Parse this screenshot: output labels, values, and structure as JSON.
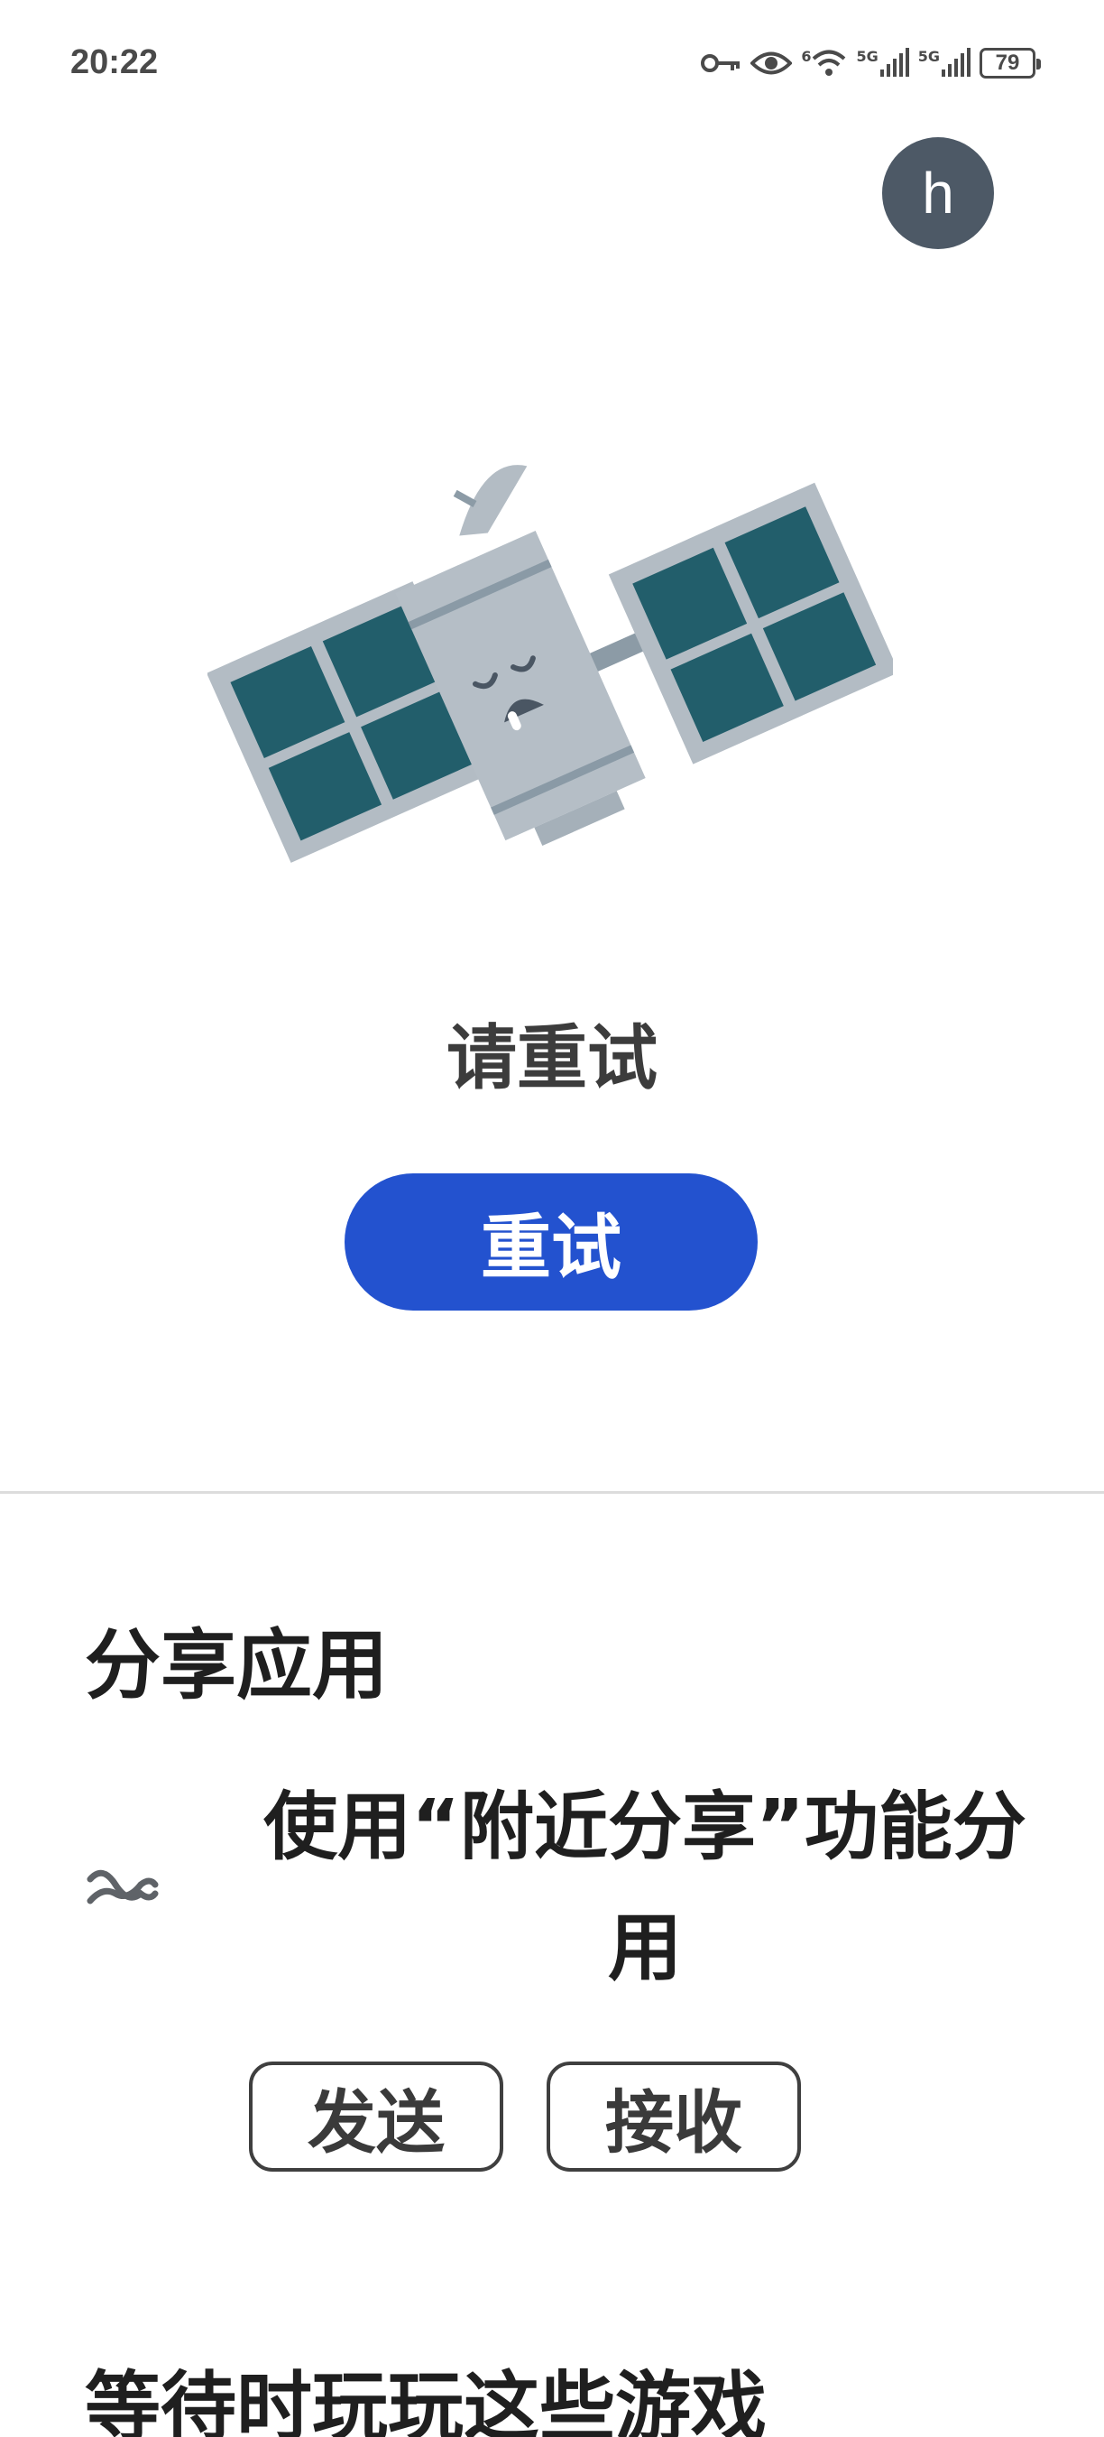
{
  "status_bar": {
    "time": "20:22",
    "icons": [
      "key-icon",
      "eye-icon",
      "wifi-icon",
      "signal-5g-icon",
      "signal-5g-icon"
    ],
    "network_labels": [
      "6",
      "5G",
      "5G"
    ],
    "battery": "79"
  },
  "account": {
    "avatar_letter": "h"
  },
  "error": {
    "illustration": "sad-satellite-illustration",
    "message": "请重试",
    "retry_label": "重试"
  },
  "share_app": {
    "title": "分享应用",
    "description": "使用“附近分享”功能分用",
    "icon": "nearby-share-icon",
    "send_label": "发送",
    "receive_label": "接收"
  },
  "games": {
    "title": "等待时玩玩这些游戏"
  },
  "colors": {
    "accent": "#2352cf",
    "avatar_bg": "#4d5966",
    "panel": "#225e6b",
    "panel_frame": "#b3bcc4",
    "satellite_body": "#b5bec6"
  }
}
